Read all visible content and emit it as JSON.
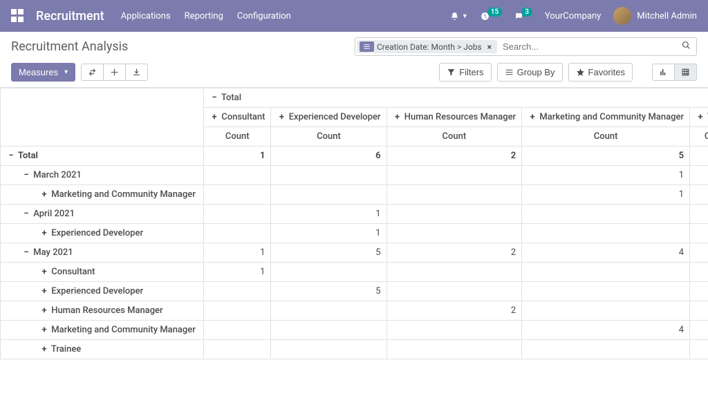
{
  "navbar": {
    "brand": "Recruitment",
    "links": [
      "Applications",
      "Reporting",
      "Configuration"
    ],
    "activity_count": "15",
    "chat_count": "3",
    "company": "YourCompany",
    "user": "Mitchell Admin"
  },
  "page": {
    "title": "Recruitment Analysis",
    "measures_label": "Measures",
    "filters_label": "Filters",
    "groupby_label": "Group By",
    "favorites_label": "Favorites",
    "search_placeholder": "Search...",
    "facet_text": "Creation Date: Month > Jobs"
  },
  "pivot": {
    "total_label": "Total",
    "count_label": "Count",
    "columns": [
      "Consultant",
      "Experienced Developer",
      "Human Resources Manager",
      "Marketing and Community Manager",
      "Trainee"
    ],
    "rows": [
      {
        "label": "Total",
        "indent": 0,
        "icon": "−",
        "bold": true,
        "vals": [
          "1",
          "6",
          "2",
          "5",
          ""
        ]
      },
      {
        "label": "March 2021",
        "indent": 1,
        "icon": "−",
        "vals": [
          "",
          "",
          "",
          "1",
          ""
        ]
      },
      {
        "label": "Marketing and Community Manager",
        "indent": 2,
        "icon": "+",
        "vals": [
          "",
          "",
          "",
          "1",
          ""
        ]
      },
      {
        "label": "April 2021",
        "indent": 1,
        "icon": "−",
        "vals": [
          "",
          "1",
          "",
          "",
          ""
        ]
      },
      {
        "label": "Experienced Developer",
        "indent": 2,
        "icon": "+",
        "vals": [
          "",
          "1",
          "",
          "",
          ""
        ]
      },
      {
        "label": "May 2021",
        "indent": 1,
        "icon": "−",
        "vals": [
          "1",
          "5",
          "2",
          "4",
          ""
        ]
      },
      {
        "label": "Consultant",
        "indent": 2,
        "icon": "+",
        "vals": [
          "1",
          "",
          "",
          "",
          ""
        ]
      },
      {
        "label": "Experienced Developer",
        "indent": 2,
        "icon": "+",
        "vals": [
          "",
          "5",
          "",
          "",
          ""
        ]
      },
      {
        "label": "Human Resources Manager",
        "indent": 2,
        "icon": "+",
        "vals": [
          "",
          "",
          "2",
          "",
          ""
        ]
      },
      {
        "label": "Marketing and Community Manager",
        "indent": 2,
        "icon": "+",
        "vals": [
          "",
          "",
          "",
          "4",
          ""
        ]
      },
      {
        "label": "Trainee",
        "indent": 2,
        "icon": "+",
        "vals": [
          "",
          "",
          "",
          "",
          ""
        ]
      }
    ]
  }
}
